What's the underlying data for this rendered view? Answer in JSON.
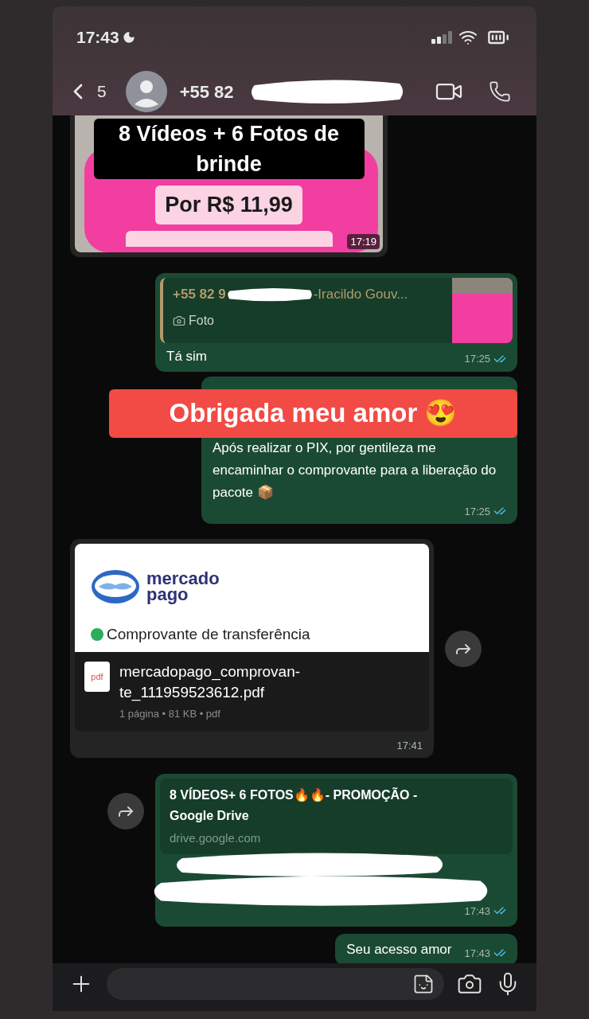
{
  "status_bar": {
    "time": "17:43"
  },
  "header": {
    "back_count": "5",
    "contact": "+55 82"
  },
  "messages": [
    {
      "kind": "image",
      "outgoing": false,
      "headline": "8 Vídeos + 6 Fotos de brinde",
      "price": "Por R$ 11,99",
      "time": "17:19"
    },
    {
      "kind": "reply",
      "outgoing": true,
      "quote": {
        "author_start": "+55 82 9",
        "author_end": "-Iracildo Gouv...",
        "label": "Foto"
      },
      "text": "Tá sim",
      "time": "17:25",
      "read": true
    },
    {
      "kind": "text",
      "outgoing": true,
      "text": "Após realizar o PIX, por gentileza me encaminhar o comprovante para a liberação do pacote 📦",
      "time": "17:25",
      "read": true,
      "overlay": "Obrigada meu amor 😍"
    },
    {
      "kind": "document",
      "outgoing": false,
      "preview": {
        "brand_line_1": "mercado",
        "brand_line_2": "pago",
        "heading": "Comprovante de transferência"
      },
      "file_icon_label": "pdf",
      "file_name": "mercadopago_comprovan-te_111959523612.pdf",
      "file_meta": "1 página • 81 KB • pdf",
      "time": "17:41",
      "forward": true
    },
    {
      "kind": "link",
      "outgoing": true,
      "title": "8 VÍDEOS+ 6 FOTOS🔥🔥- PROMOÇÃO  - Google Drive",
      "domain": "drive.google.com",
      "time": "17:43",
      "read": true,
      "forward": true
    },
    {
      "kind": "text",
      "outgoing": true,
      "text": "Seu acesso amor",
      "time": "17:43",
      "read": true
    }
  ]
}
